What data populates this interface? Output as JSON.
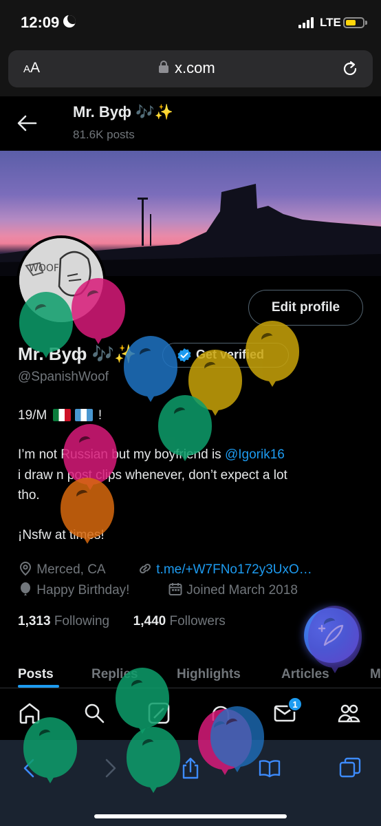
{
  "status_bar": {
    "time": "12:09",
    "network": "LTE",
    "battery_level": 0.45,
    "battery_color": "#ffd60a"
  },
  "browser": {
    "text_size_label": "AA",
    "url": "x.com",
    "icons": [
      "lock-icon",
      "reload-icon",
      "back-icon",
      "forward-icon",
      "share-icon",
      "bookmarks-icon",
      "tabs-icon"
    ]
  },
  "header": {
    "name": "Mr. Вуф",
    "name_emoji": "🎶✨",
    "post_count": "81.6K posts"
  },
  "profile": {
    "edit_button": "Edit profile",
    "display_name": "Mr. Вуф",
    "display_name_emoji": "🎶✨",
    "get_verified": "Get verified",
    "handle": "@SpanishWoof",
    "bio": {
      "line1": "19/M",
      "line1_end": "!",
      "flags": [
        "mexico-flag-icon",
        "guatemala-flag-icon"
      ],
      "line2_prefix": "I’m not Russian but my boyfriend is ",
      "line2_mention": "@Igorik16",
      "line3": "i draw n post clips whenever, don’t expect a lot",
      "line4": "tho.",
      "line5": "¡Nsfw at times!"
    },
    "location": "Merced, CA",
    "link": "t.me/+W7FNo172y3UxO…",
    "birthday": "Happy Birthday!",
    "joined": "Joined March 2018",
    "following_count": "1,313",
    "following_label": "Following",
    "followers_count": "1,440",
    "followers_label": "Followers"
  },
  "tabs": [
    "Posts",
    "Replies",
    "Highlights",
    "Articles",
    "M"
  ],
  "active_tab": "Posts",
  "bottom_nav": {
    "items": [
      "home-icon",
      "search-icon",
      "grok-icon",
      "communities-icon",
      "messages-icon",
      "people-icon"
    ],
    "messages_badge": "1"
  },
  "colors": {
    "accent": "#1d9bf0",
    "background": "#000000",
    "secondary_text": "#71767b"
  }
}
